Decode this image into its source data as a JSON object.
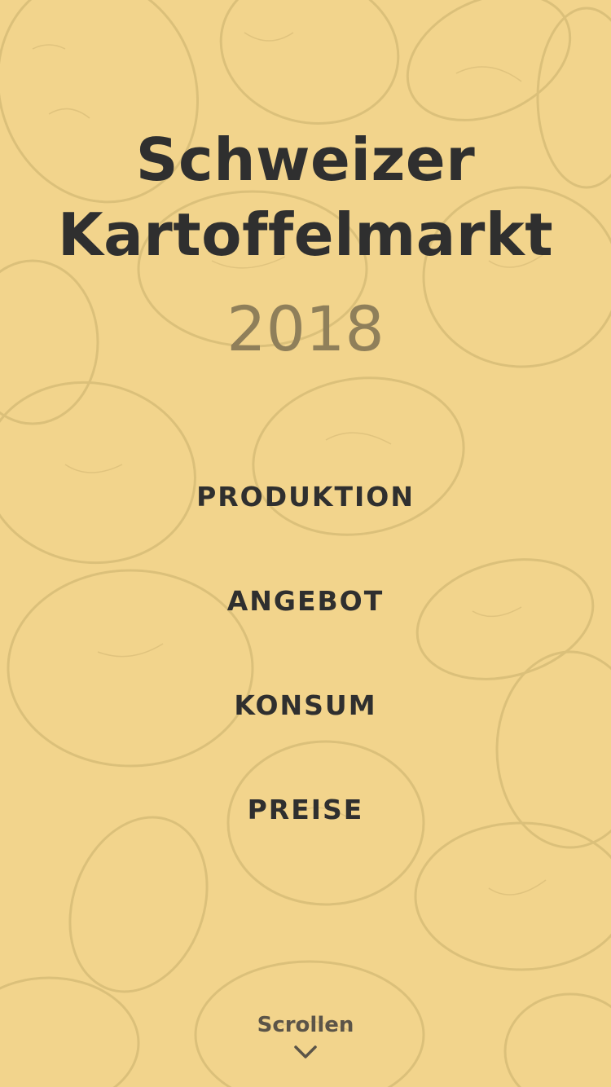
{
  "page": {
    "background_color": "#f2d48c",
    "sketch_color": "#c9b06c"
  },
  "header": {
    "title_line1": "Schweizer",
    "title_line2": "Kartoffelmarkt",
    "year": "2018"
  },
  "nav": {
    "items": [
      {
        "label": "PRODUKTION"
      },
      {
        "label": "ANGEBOT"
      },
      {
        "label": "KONSUM"
      },
      {
        "label": "PREISE"
      }
    ]
  },
  "footer": {
    "scroll_label": "Scrollen",
    "scroll_icon": "chevron-down-icon"
  }
}
